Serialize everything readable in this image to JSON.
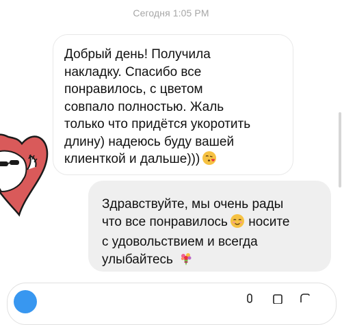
{
  "chat": {
    "timestamp": "Сегодня 1:05 PM",
    "incoming_message": {
      "lines": [
        "Добрый день! Получила",
        "накладку. Спасибо все",
        "понравилось, с цветом",
        "совпало полностью. Жаль",
        "только что придётся укоротить",
        "длину) надеюсь буду вашей",
        "клиенткой и дальше)))"
      ],
      "trailing_emoji": "kissing-face-blowing-kiss-icon"
    },
    "outgoing_message": {
      "line1": "Здравствуйте, мы очень рады",
      "line2a": "что все понравилось",
      "line2_emoji": "smiling-face-icon",
      "line2b": "носите",
      "line3": "с удовольствием и всегда",
      "line4": "улыбайтесь",
      "line4_emoji": "bouquet-icon"
    },
    "sticker": "heart-character-sticker-icon"
  },
  "colors": {
    "outgoing_bubble": "#efefef",
    "incoming_bubble_border": "#e8e8e8",
    "heart": "#d95a5a",
    "camera_button": "#3897f0"
  }
}
